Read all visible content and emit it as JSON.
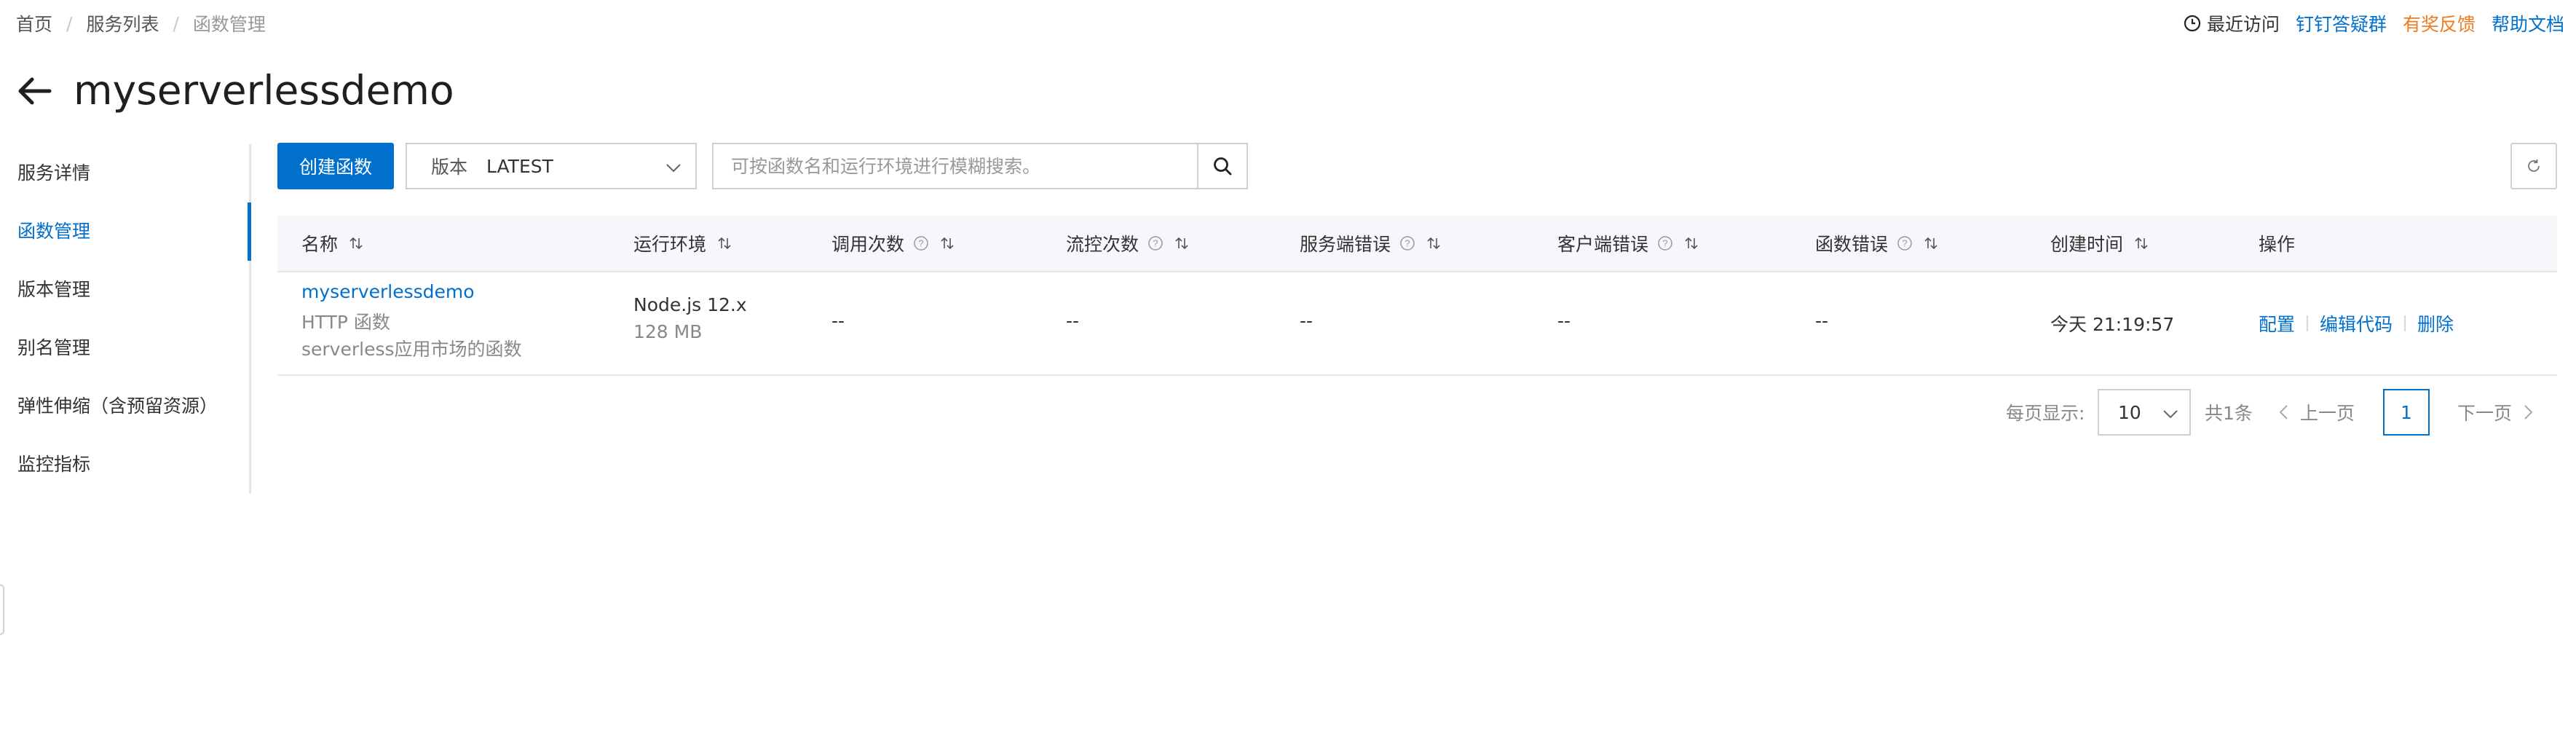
{
  "breadcrumb": [
    "首页",
    "服务列表",
    "函数管理"
  ],
  "topbar": {
    "recent": "最近访问",
    "dingtalk": "钉钉答疑群",
    "feedback": "有奖反馈",
    "help": "帮助文档"
  },
  "page_title": "myserverlessdemo",
  "sidebar": {
    "items": [
      {
        "label": "服务详情"
      },
      {
        "label": "函数管理"
      },
      {
        "label": "版本管理"
      },
      {
        "label": "别名管理"
      },
      {
        "label": "弹性伸缩（含预留资源）"
      },
      {
        "label": "监控指标"
      }
    ],
    "active_index": 1
  },
  "toolbar": {
    "create_label": "创建函数",
    "version_label": "版本",
    "version_value": "LATEST",
    "search_placeholder": "可按函数名和运行环境进行模糊搜索。"
  },
  "table": {
    "headers": [
      "名称",
      "运行环境",
      "调用次数",
      "流控次数",
      "服务端错误",
      "客户端错误",
      "函数错误",
      "创建时间",
      "操作"
    ],
    "rows": [
      {
        "name": "myserverlessdemo",
        "type": "HTTP 函数",
        "desc": "serverless应用市场的函数",
        "runtime": "Node.js 12.x",
        "memory": "128 MB",
        "invocations": "--",
        "throttles": "--",
        "server_errors": "--",
        "client_errors": "--",
        "function_errors": "--",
        "created": "今天 21:19:57",
        "ops": [
          "配置",
          "编辑代码",
          "删除"
        ]
      }
    ]
  },
  "pagination": {
    "per_page_label": "每页显示:",
    "per_page_value": "10",
    "total": "共1条",
    "prev": "上一页",
    "current": "1",
    "next": "下一页"
  },
  "colors": {
    "accent": "#0070cc",
    "feedback": "#f07c1f",
    "header_bg": "#f5f7fa"
  }
}
